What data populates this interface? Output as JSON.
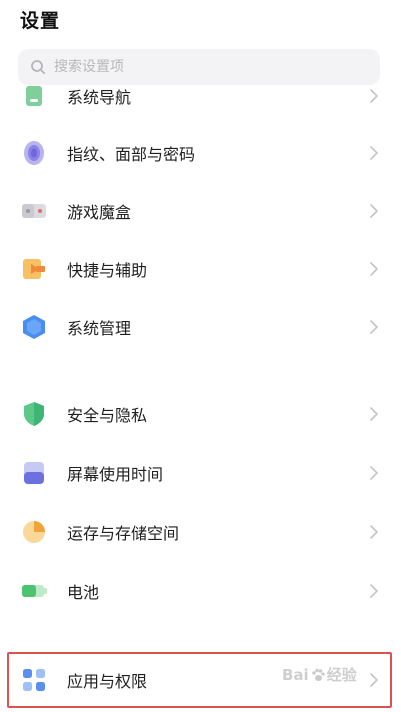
{
  "header": {
    "title": "设置"
  },
  "search": {
    "placeholder": "搜索设置项",
    "value": ""
  },
  "items": [
    {
      "label": "系统导航",
      "icon": "navigation-icon"
    },
    {
      "label": "指纹、面部与密码",
      "icon": "fingerprint-icon"
    },
    {
      "label": "游戏魔盒",
      "icon": "game-box-icon"
    },
    {
      "label": "快捷与辅助",
      "icon": "shortcut-icon"
    },
    {
      "label": "系统管理",
      "icon": "system-management-icon"
    },
    {
      "label": "安全与隐私",
      "icon": "shield-icon"
    },
    {
      "label": "屏幕使用时间",
      "icon": "screen-time-icon"
    },
    {
      "label": "运存与存储空间",
      "icon": "storage-pie-icon"
    },
    {
      "label": "电池",
      "icon": "battery-icon"
    },
    {
      "label": "应用与权限",
      "icon": "apps-grid-icon"
    }
  ],
  "watermark": {
    "text_pre": "Bai",
    "text_post": "经验"
  },
  "colors": {
    "highlight": "#d9534f",
    "search_bg": "#f3f3f5",
    "chevron": "#c4c4c8"
  }
}
